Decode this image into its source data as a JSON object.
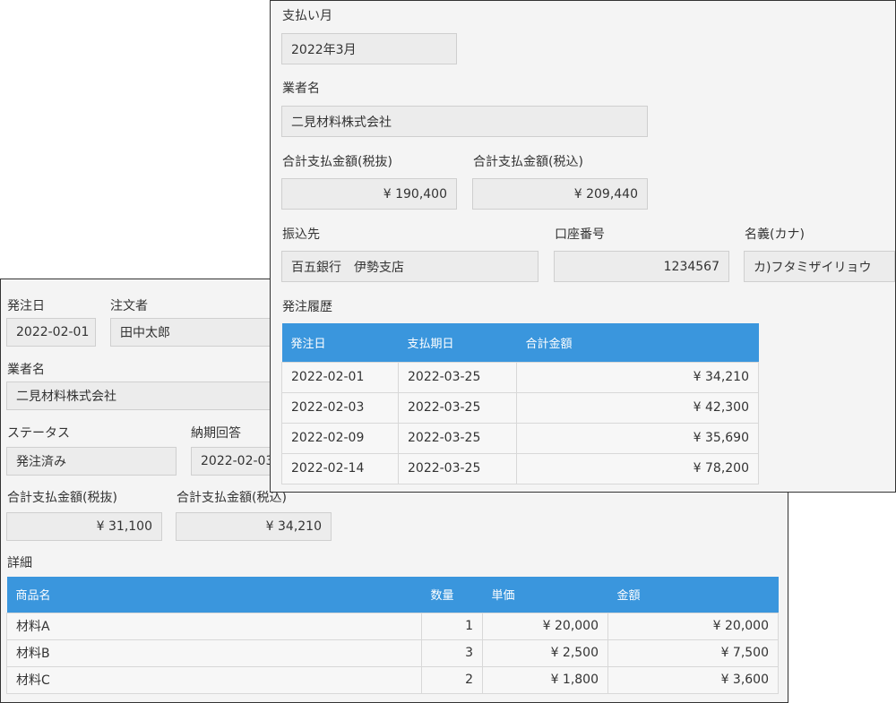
{
  "order": {
    "labels": {
      "order_date": "発注日",
      "orderer": "注文者",
      "vendor": "業者名",
      "status": "ステータス",
      "delivery": "納期回答",
      "total_ex": "合計支払金額(税抜)",
      "total_in": "合計支払金額(税込)",
      "details": "詳細"
    },
    "values": {
      "order_date": "2022-02-01",
      "orderer": "田中太郎",
      "vendor": "二見材料株式会社",
      "status": "発注済み",
      "delivery": "2022-02-03",
      "total_ex": "¥ 31,100",
      "total_in": "¥ 34,210"
    },
    "detail_table": {
      "headers": [
        "商品名",
        "数量",
        "単価",
        "金額"
      ],
      "rows": [
        [
          "材料A",
          "1",
          "¥ 20,000",
          "¥ 20,000"
        ],
        [
          "材料B",
          "3",
          "¥ 2,500",
          "¥ 7,500"
        ],
        [
          "材料C",
          "2",
          "¥ 1,800",
          "¥ 3,600"
        ]
      ]
    }
  },
  "payment": {
    "labels": {
      "month": "支払い月",
      "vendor": "業者名",
      "total_ex": "合計支払金額(税抜)",
      "total_in": "合計支払金額(税込)",
      "bank": "振込先",
      "account": "口座番号",
      "holder": "名義(カナ)",
      "history": "発注履歴"
    },
    "values": {
      "month": "2022年3月",
      "vendor": "二見材料株式会社",
      "total_ex": "¥ 190,400",
      "total_in": "¥ 209,440",
      "bank": "百五銀行　伊勢支店",
      "account": "1234567",
      "holder": "カ)フタミザイリョウ"
    },
    "history_table": {
      "headers": [
        "発注日",
        "支払期日",
        "合計金額"
      ],
      "rows": [
        [
          "2022-02-01",
          "2022-03-25",
          "¥ 34,210"
        ],
        [
          "2022-02-03",
          "2022-03-25",
          "¥ 42,300"
        ],
        [
          "2022-02-09",
          "2022-03-25",
          "¥ 35,690"
        ],
        [
          "2022-02-14",
          "2022-03-25",
          "¥ 78,200"
        ]
      ]
    }
  },
  "colors": {
    "table_header": "#3a96dd",
    "panel_background": "#f4f4f4",
    "field_background": "#ececec"
  }
}
